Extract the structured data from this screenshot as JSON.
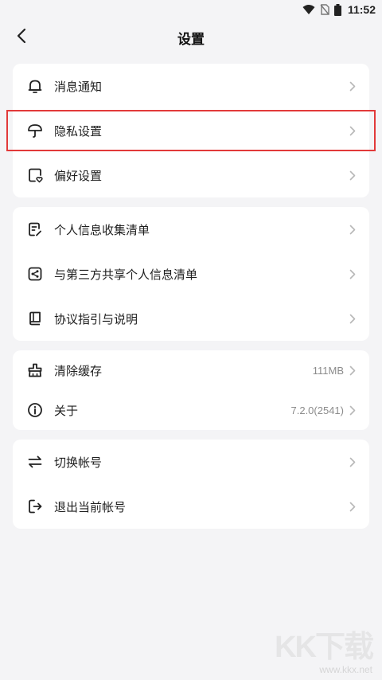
{
  "status_bar": {
    "time": "11:52",
    "icons": [
      "wifi-icon",
      "no-sim-icon",
      "battery-icon"
    ]
  },
  "header": {
    "title": "设置",
    "back_icon": "chevron-left-icon"
  },
  "groups": [
    {
      "items": [
        {
          "icon": "bell-icon",
          "label": "消息通知",
          "value": ""
        },
        {
          "icon": "umbrella-icon",
          "label": "隐私设置",
          "value": "",
          "highlighted": true
        },
        {
          "icon": "preference-heart-icon",
          "label": "偏好设置",
          "value": ""
        }
      ]
    },
    {
      "items": [
        {
          "icon": "list-edit-icon",
          "label": "个人信息收集清单",
          "value": ""
        },
        {
          "icon": "share-icon",
          "label": "与第三方共享个人信息清单",
          "value": ""
        },
        {
          "icon": "book-icon",
          "label": "协议指引与说明",
          "value": ""
        }
      ]
    },
    {
      "items": [
        {
          "icon": "broom-icon",
          "label": "清除缓存",
          "value": "111MB"
        },
        {
          "icon": "info-icon",
          "label": "关于",
          "value": "7.2.0(2541)"
        }
      ]
    },
    {
      "items": [
        {
          "icon": "switch-icon",
          "label": "切换帐号",
          "value": ""
        },
        {
          "icon": "logout-icon",
          "label": "退出当前帐号",
          "value": ""
        }
      ]
    }
  ],
  "watermark": {
    "logo": "KK下载",
    "url": "www.kkx.net"
  },
  "colors": {
    "background": "#f4f4f6",
    "card": "#ffffff",
    "highlight_border": "#e23a3a",
    "secondary_text": "#8b8b8b"
  }
}
